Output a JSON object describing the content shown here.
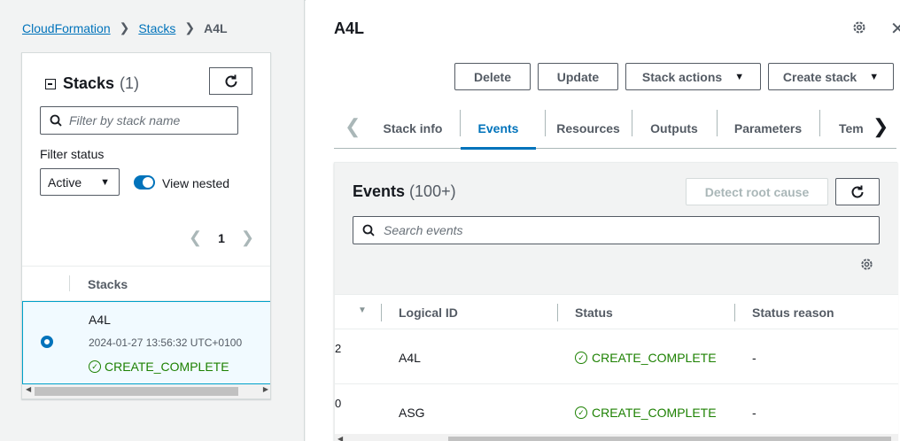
{
  "breadcrumb": {
    "root": "CloudFormation",
    "stacks": "Stacks",
    "current": "A4L"
  },
  "left_panel": {
    "title": "Stacks",
    "count": "(1)",
    "filter_placeholder": "Filter by stack name",
    "filter_status_label": "Filter status",
    "filter_status_value": "Active",
    "view_nested_label": "View nested",
    "view_nested_on": true,
    "page": "1",
    "column_header": "Stacks",
    "stack": {
      "name": "A4L",
      "created": "2024-01-27 13:56:32 UTC+0100",
      "status": "CREATE_COMPLETE"
    }
  },
  "right_panel": {
    "title": "A4L",
    "actions": {
      "delete": "Delete",
      "update": "Update",
      "stack_actions": "Stack actions",
      "create_stack": "Create stack"
    },
    "tabs": [
      "Stack info",
      "Events",
      "Resources",
      "Outputs",
      "Parameters",
      "Tem"
    ],
    "active_tab": "Events",
    "events": {
      "title": "Events",
      "count": "(100+)",
      "detect_label": "Detect root cause",
      "search_placeholder": "Search events",
      "columns": [
        "Logical ID",
        "Status",
        "Status reason"
      ],
      "rows": [
        {
          "num": "2",
          "logical_id": "A4L",
          "status": "CREATE_COMPLETE",
          "reason": "-"
        },
        {
          "num": "0",
          "logical_id": "ASG",
          "status": "CREATE_COMPLETE",
          "reason": "-"
        }
      ]
    }
  },
  "colors": {
    "link": "#0073bb",
    "success": "#1d8102",
    "selected_bg": "#f1faff",
    "border": "#545b64"
  }
}
